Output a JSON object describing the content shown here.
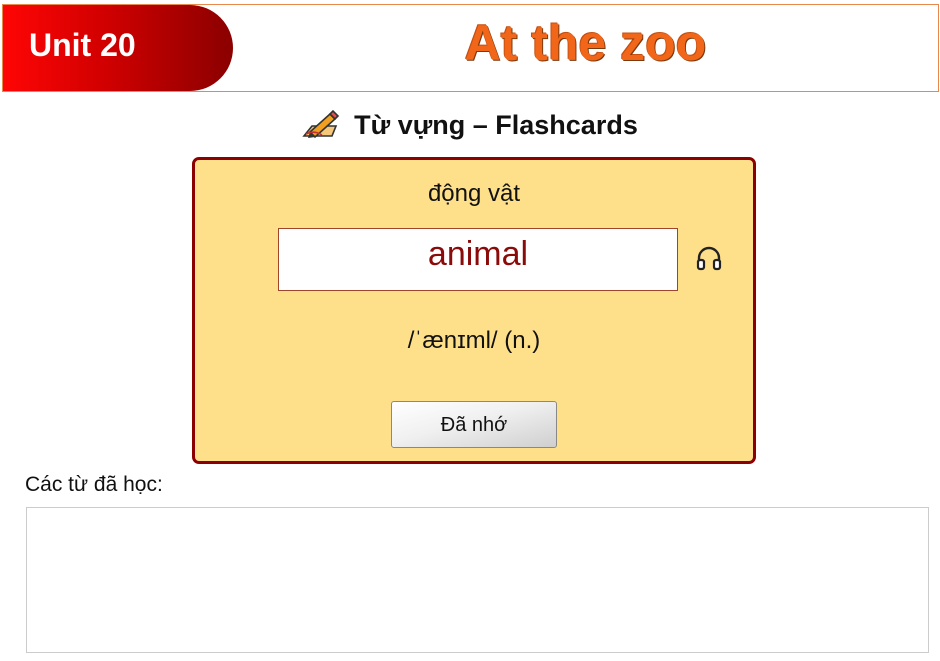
{
  "header": {
    "unit_label": "Unit 20",
    "title": "At the zoo"
  },
  "section": {
    "icon": "pencil-writing-icon",
    "heading": "Từ vựng – Flashcards"
  },
  "flashcard": {
    "meaning": "động vật",
    "word": "animal",
    "audio_icon": "headphones-icon",
    "phonetic": "/ˈænɪml/ (n.)",
    "remember_button": "Đã nhớ"
  },
  "learned": {
    "label": "Các từ đã học:",
    "items": []
  },
  "colors": {
    "badge_red": "#ff0505",
    "badge_dark": "#8a0000",
    "title_orange": "#f2661a",
    "card_bg": "#ffe08a",
    "card_border": "#8b0000",
    "word_color": "#8b0a0a"
  }
}
